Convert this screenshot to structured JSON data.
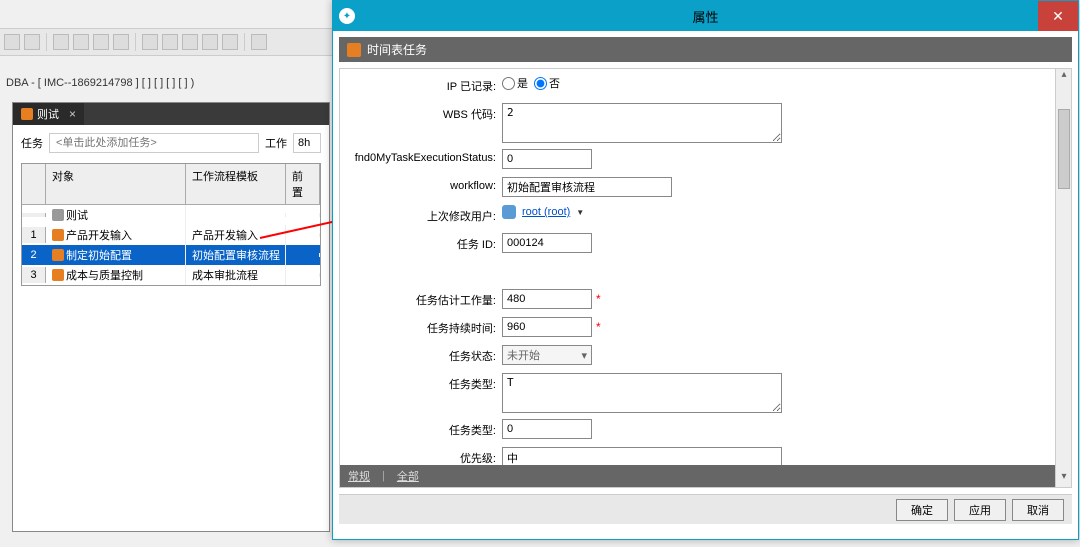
{
  "status_bar": "DBA - [ IMC--1869214798 ] [  ] [ ] [  ] [  ] )",
  "tab": {
    "title": "则试",
    "close": "×"
  },
  "filter": {
    "task_label": "任务",
    "placeholder": "<单击此处添加任务>",
    "work_label": "工作",
    "work_val": "8h"
  },
  "grid": {
    "headers": {
      "obj": "对象",
      "tpl": "工作流程模板",
      "pre": "前置"
    },
    "root": "则试",
    "rows": [
      {
        "num": "1",
        "obj": "产品开发输入",
        "tpl": "产品开发输入"
      },
      {
        "num": "2",
        "obj": "制定初始配置",
        "tpl": "初始配置审核流程"
      },
      {
        "num": "3",
        "obj": "成本与质量控制",
        "tpl": "成本审批流程"
      }
    ]
  },
  "dialog": {
    "title": "属性",
    "section": "时间表任务",
    "labels": {
      "ip_recorded": "IP 已记录:",
      "yes": "是",
      "no": "否",
      "wbs": "WBS 代码:",
      "exec_status": "fnd0MyTaskExecutionStatus:",
      "workflow": "workflow:",
      "last_user": "上次修改用户:",
      "task_id": "任务 ID:",
      "est_work": "任务估计工作量:",
      "duration": "任务持续时间:",
      "status": "任务状态:",
      "type1": "任务类型:",
      "type2": "任务类型:",
      "priority": "优先级:"
    },
    "values": {
      "wbs": "2",
      "exec_status": "0",
      "workflow": "初始配置审核流程",
      "last_user": "root (root)",
      "task_id": "000124",
      "est_work": "480",
      "duration": "960",
      "status": "未开始",
      "type1": "T",
      "type2": "0",
      "priority": "中"
    },
    "tabs": {
      "general": "常规",
      "all": "全部"
    },
    "buttons": {
      "ok": "确定",
      "apply": "应用",
      "cancel": "取消"
    }
  }
}
